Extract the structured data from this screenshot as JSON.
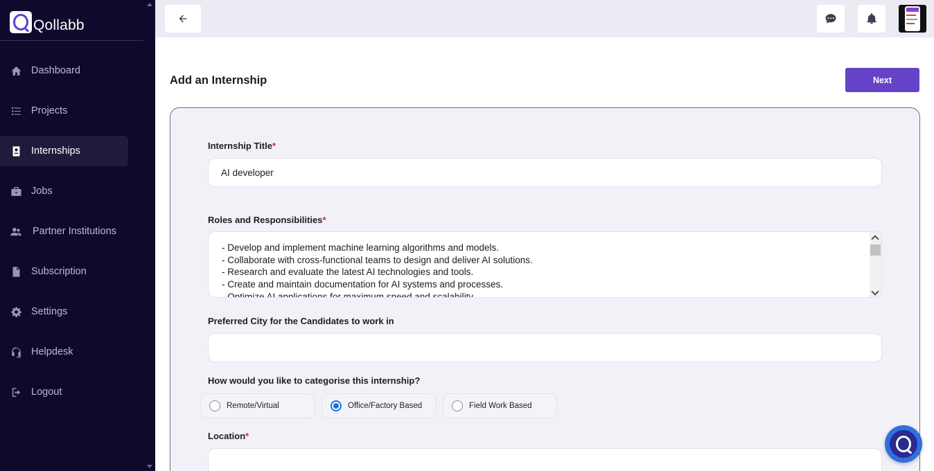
{
  "app": {
    "brand": "Qollabb"
  },
  "sidebar": {
    "items": [
      {
        "label": "Dashboard",
        "icon": "home-icon",
        "active": false
      },
      {
        "label": "Projects",
        "icon": "list-icon",
        "active": false
      },
      {
        "label": "Internships",
        "icon": "badge-icon",
        "active": true
      },
      {
        "label": "Jobs",
        "icon": "briefcase-icon",
        "active": false
      },
      {
        "label": "Partner Institutions",
        "icon": "users-icon",
        "active": false
      },
      {
        "label": "Subscription",
        "icon": "file-dollar-icon",
        "active": false
      },
      {
        "label": "Settings",
        "icon": "gear-icon",
        "active": false
      },
      {
        "label": "Helpdesk",
        "icon": "headset-icon",
        "active": false
      },
      {
        "label": "Logout",
        "icon": "logout-icon",
        "active": false
      }
    ]
  },
  "topbar": {
    "back_icon": "arrow-left-icon",
    "chat_icon": "chat-icon",
    "bell_icon": "bell-icon"
  },
  "page": {
    "title": "Add an Internship",
    "next_label": "Next"
  },
  "form": {
    "title_label": "Internship Title",
    "title_value": "AI developer",
    "roles_label": "Roles and Responsibilities",
    "roles_value": "- Develop and implement machine learning algorithms and models.\n- Collaborate with cross-functional teams to design and deliver AI solutions.\n- Research and evaluate the latest AI technologies and tools.\n- Create and maintain documentation for AI systems and processes.\n- Optimize AI applications for maximum speed and scalability.",
    "city_label": "Preferred City for the Candidates to work in",
    "city_value": "",
    "category_label": "How would you like to categorise this internship?",
    "category_options": [
      {
        "label": "Remote/Virtual",
        "checked": false
      },
      {
        "label": "Office/Factory Based",
        "checked": true
      },
      {
        "label": "Field Work Based",
        "checked": false
      }
    ],
    "location_label": "Location",
    "location_value": "",
    "required_marker": "*"
  },
  "colors": {
    "sidebar_bg": "#0e0a2b",
    "accent": "#6443c9",
    "required": "#e0263b",
    "radio_checked": "#1a73e8"
  }
}
